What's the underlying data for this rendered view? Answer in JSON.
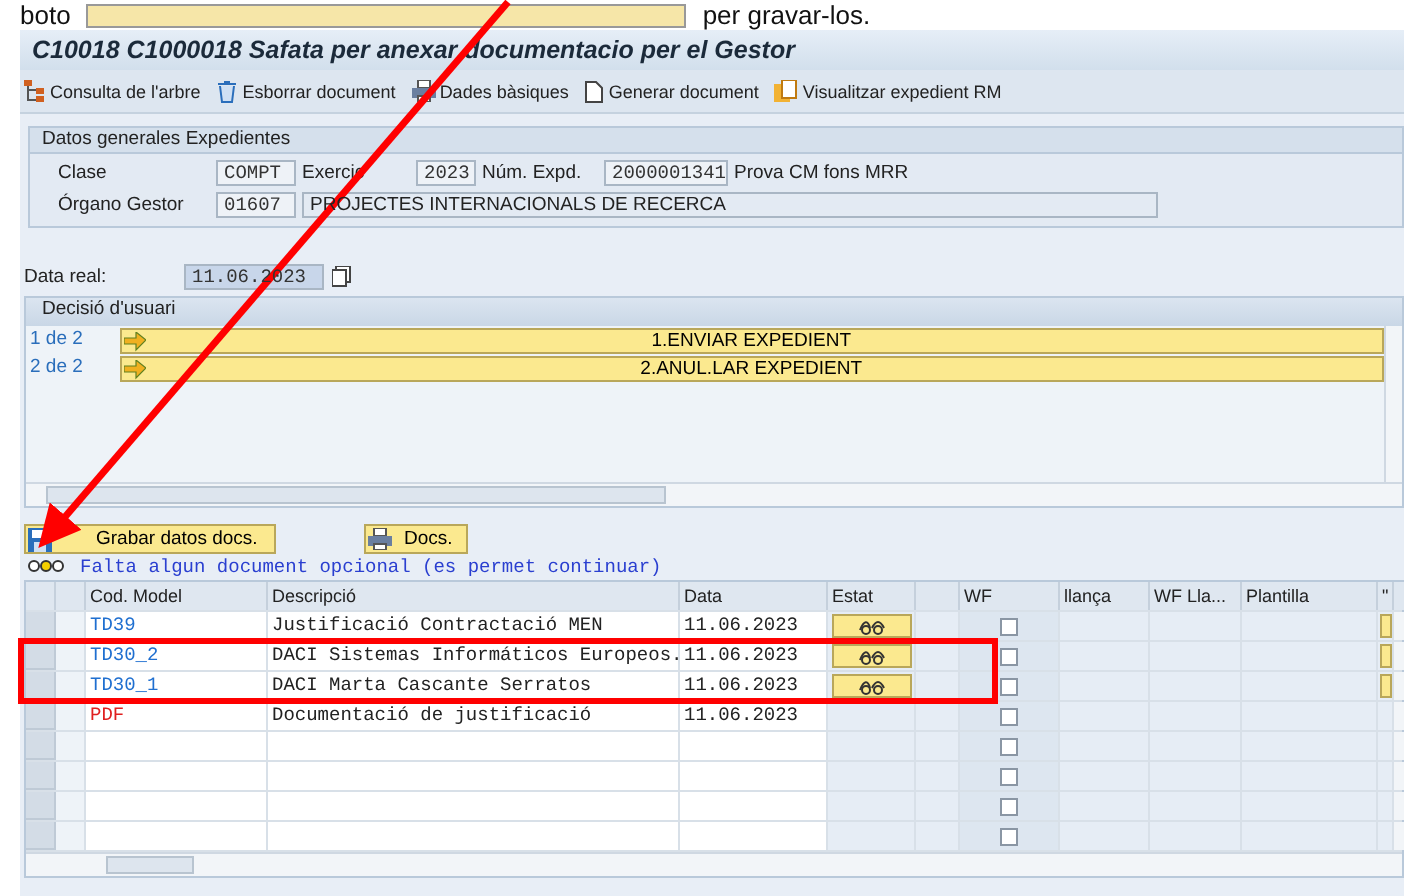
{
  "caption": {
    "before": "boto",
    "after": "per gravar-los."
  },
  "title": "C10018 C1000018 Safata per anexar documentacio per el Gestor",
  "toolbar": [
    {
      "kind": "tree",
      "label": "Consulta de l'arbre"
    },
    {
      "kind": "trash",
      "label": "Esborrar document"
    },
    {
      "kind": "printer",
      "label": "Dades bàsiques"
    },
    {
      "kind": "page",
      "label": "Generar document"
    },
    {
      "kind": "folder",
      "label": "Visualitzar expedient RM"
    }
  ],
  "general": {
    "title": "Datos generales Expedientes",
    "clase_label": "Clase",
    "clase": "COMPT",
    "exercici_label": "Exercic",
    "exercici": "2023",
    "num_label": "Núm. Expd.",
    "num": "2000001341",
    "num_text": "Prova CM fons MRR",
    "organo_label": "Órgano Gestor",
    "organo": "01607",
    "organo_text": "PROJECTES INTERNACIONALS DE RECERCA"
  },
  "data_real": {
    "label": "Data real:",
    "value": "11.06.2023"
  },
  "decision": {
    "title": "Decisió d'usuari",
    "rows": [
      {
        "index": "1 de 2",
        "label": "1.ENVIAR EXPEDIENT"
      },
      {
        "index": "2 de 2",
        "label": "2.ANUL.LAR EXPEDIENT"
      }
    ]
  },
  "buttons": [
    "Grabar datos docs.",
    "Docs."
  ],
  "message": "Falta algun document opcional (es permet continuar)",
  "table": {
    "columns": [
      "Cod. Model",
      "Descripció",
      "Data",
      "Estat",
      "WF",
      "llança",
      "WF Lla...",
      "Plantilla",
      "\""
    ],
    "rows": [
      {
        "code": "TD39",
        "color": "#1f6fd0",
        "description": "Justificació Contractació MEN",
        "date": "11.06.2023",
        "status_button": true,
        "wf_checked": false
      },
      {
        "code": "TD30_2",
        "color": "#1f6fd0",
        "description": "DACI Sistemas Informáticos Europeos.",
        "date": "11.06.2023",
        "status_button": true,
        "wf_checked": false
      },
      {
        "code": "TD30_1",
        "color": "#1f6fd0",
        "description": "DACI Marta Cascante Serratos",
        "date": "11.06.2023",
        "status_button": true,
        "wf_checked": false
      },
      {
        "code": "PDF",
        "color": "#e02020",
        "description": "Documentació de justificació",
        "date": "11.06.2023",
        "status_button": false,
        "wf_checked": false
      },
      {
        "wf_checked": false
      },
      {
        "wf_checked": false
      },
      {
        "wf_checked": false
      },
      {
        "wf_checked": false
      }
    ]
  }
}
